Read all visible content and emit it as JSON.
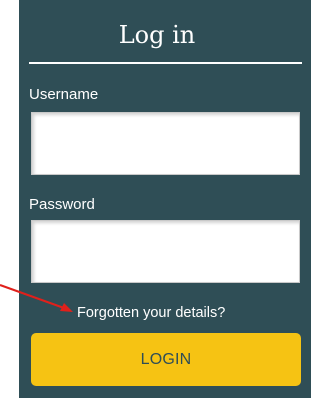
{
  "login_panel": {
    "title": "Log in",
    "username_label": "Username",
    "username_value": "",
    "password_label": "Password",
    "password_value": "",
    "forgot_link": "Forgotten your details?",
    "login_button": "LOGIN"
  },
  "colors": {
    "panel_background": "#2f4e56",
    "button_background": "#f6c313",
    "annotation_arrow": "#e0201b"
  },
  "annotation": {
    "icon": "red-arrow-icon"
  }
}
